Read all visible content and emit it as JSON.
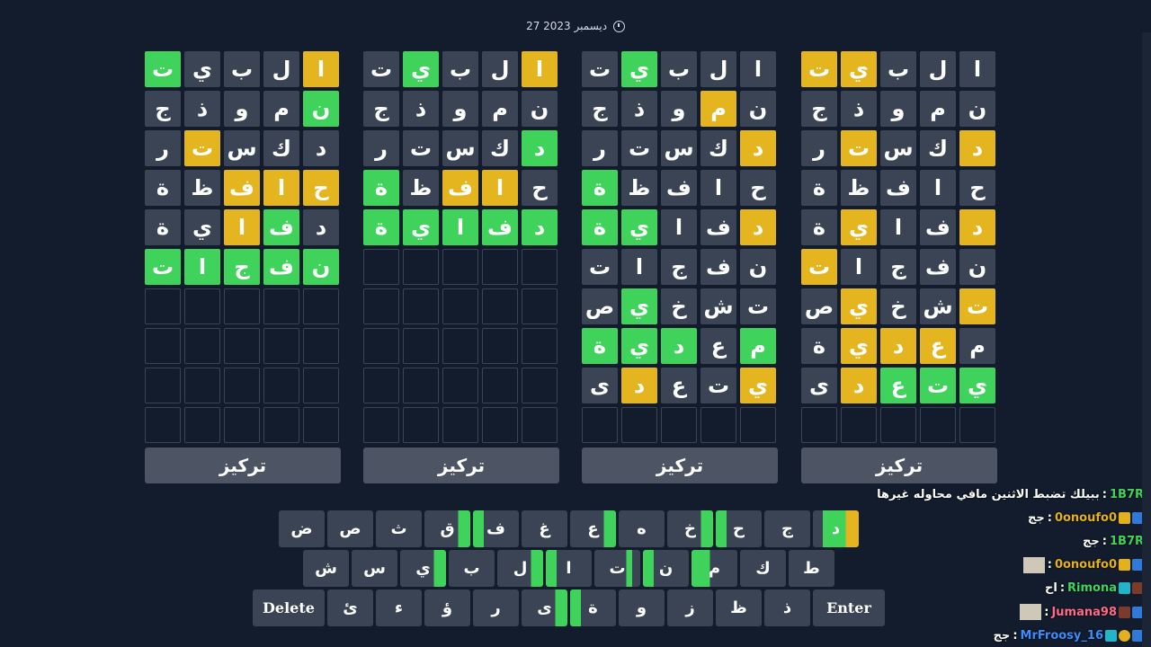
{
  "date_text": "27 ديسمبر 2023",
  "focus_label": "تركيز",
  "boards": [
    {
      "rows": [
        [
          {
            "l": "ا",
            "s": "y"
          },
          {
            "l": "ل",
            "s": "n"
          },
          {
            "l": "ب",
            "s": "n"
          },
          {
            "l": "ي",
            "s": "n"
          },
          {
            "l": "ت",
            "s": "g"
          }
        ],
        [
          {
            "l": "ن",
            "s": "g"
          },
          {
            "l": "م",
            "s": "n"
          },
          {
            "l": "و",
            "s": "n"
          },
          {
            "l": "ذ",
            "s": "n"
          },
          {
            "l": "ج",
            "s": "n"
          }
        ],
        [
          {
            "l": "د",
            "s": "n"
          },
          {
            "l": "ك",
            "s": "n"
          },
          {
            "l": "س",
            "s": "n"
          },
          {
            "l": "ت",
            "s": "y"
          },
          {
            "l": "ر",
            "s": "n"
          }
        ],
        [
          {
            "l": "ح",
            "s": "y"
          },
          {
            "l": "ا",
            "s": "y"
          },
          {
            "l": "ف",
            "s": "y"
          },
          {
            "l": "ظ",
            "s": "n"
          },
          {
            "l": "ة",
            "s": "n"
          }
        ],
        [
          {
            "l": "د",
            "s": "n"
          },
          {
            "l": "ف",
            "s": "g"
          },
          {
            "l": "ا",
            "s": "y"
          },
          {
            "l": "ي",
            "s": "n"
          },
          {
            "l": "ة",
            "s": "n"
          }
        ],
        [
          {
            "l": "ن",
            "s": "g"
          },
          {
            "l": "ف",
            "s": "g"
          },
          {
            "l": "ج",
            "s": "g"
          },
          {
            "l": "ا",
            "s": "g"
          },
          {
            "l": "ت",
            "s": "g"
          }
        ],
        [
          {
            "l": "",
            "s": "e"
          },
          {
            "l": "",
            "s": "e"
          },
          {
            "l": "",
            "s": "e"
          },
          {
            "l": "",
            "s": "e"
          },
          {
            "l": "",
            "s": "e"
          }
        ],
        [
          {
            "l": "",
            "s": "e"
          },
          {
            "l": "",
            "s": "e"
          },
          {
            "l": "",
            "s": "e"
          },
          {
            "l": "",
            "s": "e"
          },
          {
            "l": "",
            "s": "e"
          }
        ],
        [
          {
            "l": "",
            "s": "e"
          },
          {
            "l": "",
            "s": "e"
          },
          {
            "l": "",
            "s": "e"
          },
          {
            "l": "",
            "s": "e"
          },
          {
            "l": "",
            "s": "e"
          }
        ],
        [
          {
            "l": "",
            "s": "e"
          },
          {
            "l": "",
            "s": "e"
          },
          {
            "l": "",
            "s": "e"
          },
          {
            "l": "",
            "s": "e"
          },
          {
            "l": "",
            "s": "e"
          }
        ]
      ]
    },
    {
      "rows": [
        [
          {
            "l": "ا",
            "s": "y"
          },
          {
            "l": "ل",
            "s": "n"
          },
          {
            "l": "ب",
            "s": "n"
          },
          {
            "l": "ي",
            "s": "g"
          },
          {
            "l": "ت",
            "s": "n"
          }
        ],
        [
          {
            "l": "ن",
            "s": "n"
          },
          {
            "l": "م",
            "s": "n"
          },
          {
            "l": "و",
            "s": "n"
          },
          {
            "l": "ذ",
            "s": "n"
          },
          {
            "l": "ج",
            "s": "n"
          }
        ],
        [
          {
            "l": "د",
            "s": "g"
          },
          {
            "l": "ك",
            "s": "n"
          },
          {
            "l": "س",
            "s": "n"
          },
          {
            "l": "ت",
            "s": "n"
          },
          {
            "l": "ر",
            "s": "n"
          }
        ],
        [
          {
            "l": "ح",
            "s": "n"
          },
          {
            "l": "ا",
            "s": "y"
          },
          {
            "l": "ف",
            "s": "y"
          },
          {
            "l": "ظ",
            "s": "n"
          },
          {
            "l": "ة",
            "s": "g"
          }
        ],
        [
          {
            "l": "د",
            "s": "g"
          },
          {
            "l": "ف",
            "s": "g"
          },
          {
            "l": "ا",
            "s": "g"
          },
          {
            "l": "ي",
            "s": "g"
          },
          {
            "l": "ة",
            "s": "g"
          }
        ],
        [
          {
            "l": "",
            "s": "e"
          },
          {
            "l": "",
            "s": "e"
          },
          {
            "l": "",
            "s": "e"
          },
          {
            "l": "",
            "s": "e"
          },
          {
            "l": "",
            "s": "e"
          }
        ],
        [
          {
            "l": "",
            "s": "e"
          },
          {
            "l": "",
            "s": "e"
          },
          {
            "l": "",
            "s": "e"
          },
          {
            "l": "",
            "s": "e"
          },
          {
            "l": "",
            "s": "e"
          }
        ],
        [
          {
            "l": "",
            "s": "e"
          },
          {
            "l": "",
            "s": "e"
          },
          {
            "l": "",
            "s": "e"
          },
          {
            "l": "",
            "s": "e"
          },
          {
            "l": "",
            "s": "e"
          }
        ],
        [
          {
            "l": "",
            "s": "e"
          },
          {
            "l": "",
            "s": "e"
          },
          {
            "l": "",
            "s": "e"
          },
          {
            "l": "",
            "s": "e"
          },
          {
            "l": "",
            "s": "e"
          }
        ],
        [
          {
            "l": "",
            "s": "e"
          },
          {
            "l": "",
            "s": "e"
          },
          {
            "l": "",
            "s": "e"
          },
          {
            "l": "",
            "s": "e"
          },
          {
            "l": "",
            "s": "e"
          }
        ]
      ]
    },
    {
      "rows": [
        [
          {
            "l": "ا",
            "s": "n"
          },
          {
            "l": "ل",
            "s": "n"
          },
          {
            "l": "ب",
            "s": "n"
          },
          {
            "l": "ي",
            "s": "g"
          },
          {
            "l": "ت",
            "s": "n"
          }
        ],
        [
          {
            "l": "ن",
            "s": "n"
          },
          {
            "l": "م",
            "s": "y"
          },
          {
            "l": "و",
            "s": "n"
          },
          {
            "l": "ذ",
            "s": "n"
          },
          {
            "l": "ج",
            "s": "n"
          }
        ],
        [
          {
            "l": "د",
            "s": "y"
          },
          {
            "l": "ك",
            "s": "n"
          },
          {
            "l": "س",
            "s": "n"
          },
          {
            "l": "ت",
            "s": "n"
          },
          {
            "l": "ر",
            "s": "n"
          }
        ],
        [
          {
            "l": "ح",
            "s": "n"
          },
          {
            "l": "ا",
            "s": "n"
          },
          {
            "l": "ف",
            "s": "n"
          },
          {
            "l": "ظ",
            "s": "n"
          },
          {
            "l": "ة",
            "s": "g"
          }
        ],
        [
          {
            "l": "د",
            "s": "y"
          },
          {
            "l": "ف",
            "s": "n"
          },
          {
            "l": "ا",
            "s": "n"
          },
          {
            "l": "ي",
            "s": "g"
          },
          {
            "l": "ة",
            "s": "g"
          }
        ],
        [
          {
            "l": "ن",
            "s": "n"
          },
          {
            "l": "ف",
            "s": "n"
          },
          {
            "l": "ج",
            "s": "n"
          },
          {
            "l": "ا",
            "s": "n"
          },
          {
            "l": "ت",
            "s": "n"
          }
        ],
        [
          {
            "l": "ت",
            "s": "n"
          },
          {
            "l": "ش",
            "s": "n"
          },
          {
            "l": "خ",
            "s": "n"
          },
          {
            "l": "ي",
            "s": "g"
          },
          {
            "l": "ص",
            "s": "n"
          }
        ],
        [
          {
            "l": "م",
            "s": "g"
          },
          {
            "l": "ع",
            "s": "n"
          },
          {
            "l": "د",
            "s": "g"
          },
          {
            "l": "ي",
            "s": "g"
          },
          {
            "l": "ة",
            "s": "g"
          }
        ],
        [
          {
            "l": "ي",
            "s": "y"
          },
          {
            "l": "ت",
            "s": "n"
          },
          {
            "l": "ع",
            "s": "n"
          },
          {
            "l": "د",
            "s": "y"
          },
          {
            "l": "ى",
            "s": "n"
          }
        ],
        [
          {
            "l": "",
            "s": "e"
          },
          {
            "l": "",
            "s": "e"
          },
          {
            "l": "",
            "s": "e"
          },
          {
            "l": "",
            "s": "e"
          },
          {
            "l": "",
            "s": "e"
          }
        ]
      ]
    },
    {
      "rows": [
        [
          {
            "l": "ا",
            "s": "n"
          },
          {
            "l": "ل",
            "s": "n"
          },
          {
            "l": "ب",
            "s": "n"
          },
          {
            "l": "ي",
            "s": "y"
          },
          {
            "l": "ت",
            "s": "y"
          }
        ],
        [
          {
            "l": "ن",
            "s": "n"
          },
          {
            "l": "م",
            "s": "n"
          },
          {
            "l": "و",
            "s": "n"
          },
          {
            "l": "ذ",
            "s": "n"
          },
          {
            "l": "ج",
            "s": "n"
          }
        ],
        [
          {
            "l": "د",
            "s": "y"
          },
          {
            "l": "ك",
            "s": "n"
          },
          {
            "l": "س",
            "s": "n"
          },
          {
            "l": "ت",
            "s": "y"
          },
          {
            "l": "ر",
            "s": "n"
          }
        ],
        [
          {
            "l": "ح",
            "s": "n"
          },
          {
            "l": "ا",
            "s": "n"
          },
          {
            "l": "ف",
            "s": "n"
          },
          {
            "l": "ظ",
            "s": "n"
          },
          {
            "l": "ة",
            "s": "n"
          }
        ],
        [
          {
            "l": "د",
            "s": "y"
          },
          {
            "l": "ف",
            "s": "n"
          },
          {
            "l": "ا",
            "s": "n"
          },
          {
            "l": "ي",
            "s": "y"
          },
          {
            "l": "ة",
            "s": "n"
          }
        ],
        [
          {
            "l": "ن",
            "s": "n"
          },
          {
            "l": "ف",
            "s": "n"
          },
          {
            "l": "ج",
            "s": "n"
          },
          {
            "l": "ا",
            "s": "n"
          },
          {
            "l": "ت",
            "s": "y"
          }
        ],
        [
          {
            "l": "ت",
            "s": "y"
          },
          {
            "l": "ش",
            "s": "n"
          },
          {
            "l": "خ",
            "s": "n"
          },
          {
            "l": "ي",
            "s": "y"
          },
          {
            "l": "ص",
            "s": "n"
          }
        ],
        [
          {
            "l": "م",
            "s": "n"
          },
          {
            "l": "ع",
            "s": "y"
          },
          {
            "l": "د",
            "s": "y"
          },
          {
            "l": "ي",
            "s": "y"
          },
          {
            "l": "ة",
            "s": "n"
          }
        ],
        [
          {
            "l": "ي",
            "s": "g"
          },
          {
            "l": "ت",
            "s": "g"
          },
          {
            "l": "ع",
            "s": "g"
          },
          {
            "l": "د",
            "s": "y"
          },
          {
            "l": "ى",
            "s": "n"
          }
        ],
        [
          {
            "l": "",
            "s": "e"
          },
          {
            "l": "",
            "s": "e"
          },
          {
            "l": "",
            "s": "e"
          },
          {
            "l": "",
            "s": "e"
          },
          {
            "l": "",
            "s": "e"
          }
        ]
      ]
    }
  ],
  "keyboard": {
    "row1": [
      {
        "l": "ض",
        "s": "n"
      },
      {
        "l": "ص",
        "s": "n"
      },
      {
        "l": "ث",
        "s": "n"
      },
      {
        "l": "ق",
        "s": "gr"
      },
      {
        "l": "ف",
        "s": "gl"
      },
      {
        "l": "غ",
        "s": "n"
      },
      {
        "l": "ع",
        "s": "gr"
      },
      {
        "l": "ه",
        "s": "n"
      },
      {
        "l": "خ",
        "s": "gr"
      },
      {
        "l": "ح",
        "s": "gl"
      },
      {
        "l": "ج",
        "s": "n"
      },
      {
        "l": "د",
        "s": "gy"
      }
    ],
    "row2": [
      {
        "l": "ش",
        "s": "n"
      },
      {
        "l": "س",
        "s": "n"
      },
      {
        "l": "ي",
        "s": "gr"
      },
      {
        "l": "ب",
        "s": "n"
      },
      {
        "l": "ل",
        "s": "gr"
      },
      {
        "l": "ا",
        "s": "gl"
      },
      {
        "l": "ت",
        "s": "gm"
      },
      {
        "l": "ن",
        "s": "gl"
      },
      {
        "l": "م",
        "s": "gs"
      },
      {
        "l": "ك",
        "s": "n"
      },
      {
        "l": "ط",
        "s": "n"
      }
    ],
    "row3": [
      {
        "l": "Delete",
        "s": "wide"
      },
      {
        "l": "ئ",
        "s": "n"
      },
      {
        "l": "ء",
        "s": "n"
      },
      {
        "l": "ؤ",
        "s": "n"
      },
      {
        "l": "ر",
        "s": "n"
      },
      {
        "l": "ى",
        "s": "gr"
      },
      {
        "l": "ة",
        "s": "gl"
      },
      {
        "l": "و",
        "s": "n"
      },
      {
        "l": "ز",
        "s": "n"
      },
      {
        "l": "ظ",
        "s": "n"
      },
      {
        "l": "ذ",
        "s": "n"
      },
      {
        "l": "Enter",
        "s": "wide"
      }
    ]
  },
  "chat": [
    {
      "user": "1B7R",
      "color": "#3fd35c",
      "text": "ببيلك تضبط الاثنين مافي محاوله غيرها",
      "badges": []
    },
    {
      "user": "0onoufo0",
      "color": "#e3b11c",
      "text": "جج",
      "badges": [
        "blue",
        "crown"
      ]
    },
    {
      "user": "1B7R",
      "color": "#3fd35c",
      "text": "جج",
      "badges": []
    },
    {
      "user": "0onoufo0",
      "color": "#e3b11c",
      "text": "",
      "badges": [
        "blue",
        "crown"
      ],
      "avatar": true
    },
    {
      "user": "Rimona",
      "color": "#3fd35c",
      "text": "اح",
      "badges": [
        "sub",
        "teal"
      ]
    },
    {
      "user": "Jumana98",
      "color": "#ff6a8a",
      "text": "",
      "badges": [
        "blue",
        "sub"
      ],
      "avatar": true
    },
    {
      "user": "MrFroosy_16",
      "color": "#3b8cff",
      "text": "جج",
      "badges": [
        "blue",
        "bits",
        "teal"
      ]
    }
  ],
  "colors": {
    "green": "#3fd35c",
    "yellow": "#e5b51f",
    "tile": "#3a4454",
    "bg": "#131c2c"
  }
}
